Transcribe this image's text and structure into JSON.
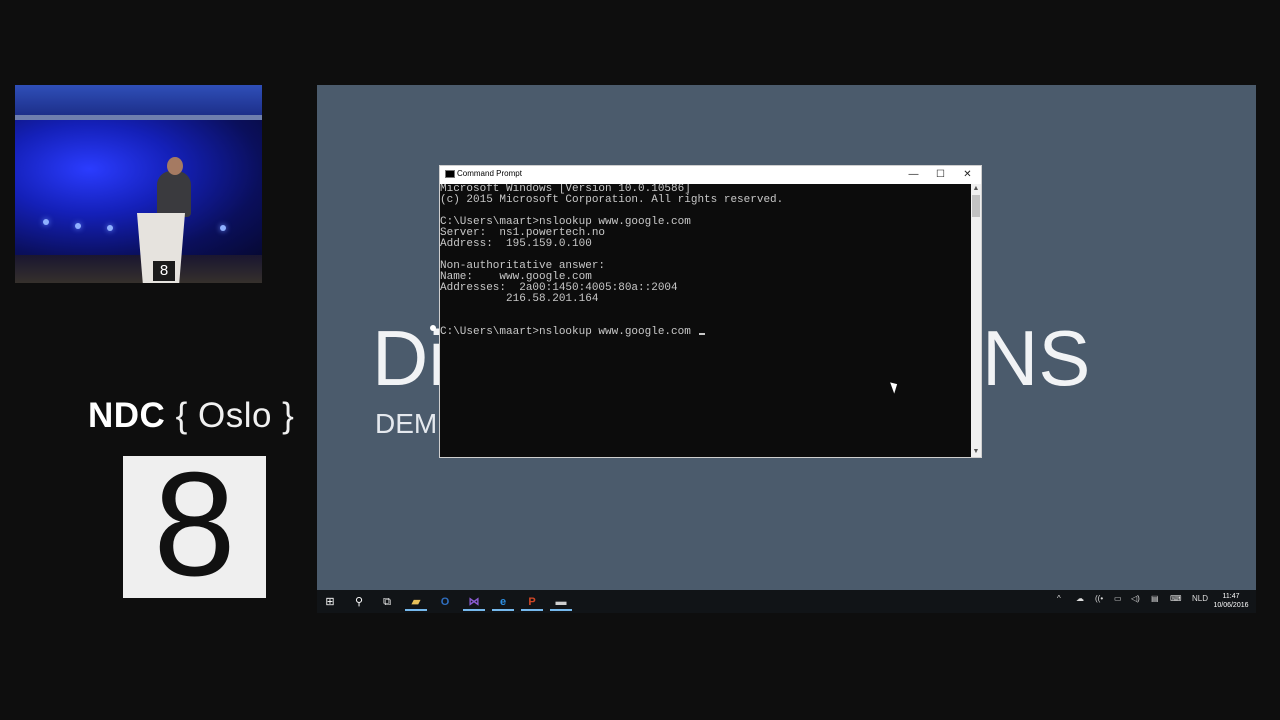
{
  "branding": {
    "ndc_bold": "NDC",
    "ndc_rest": "{ Oslo }",
    "badge_number": "8"
  },
  "camera": {
    "podium_badge": "8"
  },
  "slide": {
    "title_left": "Di",
    "title_right": "NS",
    "subtitle": "DEM"
  },
  "cmd": {
    "window_title": "Command Prompt",
    "minimize_label": "—",
    "maximize_label": "☐",
    "close_label": "✕",
    "lines": [
      "Microsoft Windows [Version 10.0.10586]",
      "(c) 2015 Microsoft Corporation. All rights reserved.",
      "",
      "C:\\Users\\maart>nslookup www.google.com",
      "Server:  ns1.powertech.no",
      "Address:  195.159.0.100",
      "",
      "Non-authoritative answer:",
      "Name:    www.google.com",
      "Addresses:  2a00:1450:4005:80a::2004",
      "          216.58.201.164",
      "",
      "",
      "C:\\Users\\maart>nslookup www.google.com "
    ]
  },
  "taskbar": {
    "start_icon": "⊞",
    "search_icon": "⚲",
    "taskview_icon": "⧉",
    "apps": [
      {
        "name": "file-explorer",
        "glyph": "▰",
        "color": "#e8c15a",
        "active": true
      },
      {
        "name": "outlook",
        "glyph": "O",
        "color": "#2f6fc1",
        "active": false
      },
      {
        "name": "visual-studio",
        "glyph": "⋈",
        "color": "#8a5bd1",
        "active": true
      },
      {
        "name": "edge",
        "glyph": "e",
        "color": "#2d8fe3",
        "active": true
      },
      {
        "name": "powerpoint",
        "glyph": "P",
        "color": "#d24726",
        "active": true
      },
      {
        "name": "command-prompt",
        "glyph": "▬",
        "color": "#cfcfcf",
        "active": true
      }
    ],
    "tray": {
      "chevron": "^",
      "onedrive": "☁",
      "network": "((•",
      "battery": "▭",
      "volume": "◁)",
      "notifications": "▤",
      "keyboard": "⌨",
      "language": "NLD"
    },
    "time": "11:47",
    "date": "10/06/2016"
  }
}
